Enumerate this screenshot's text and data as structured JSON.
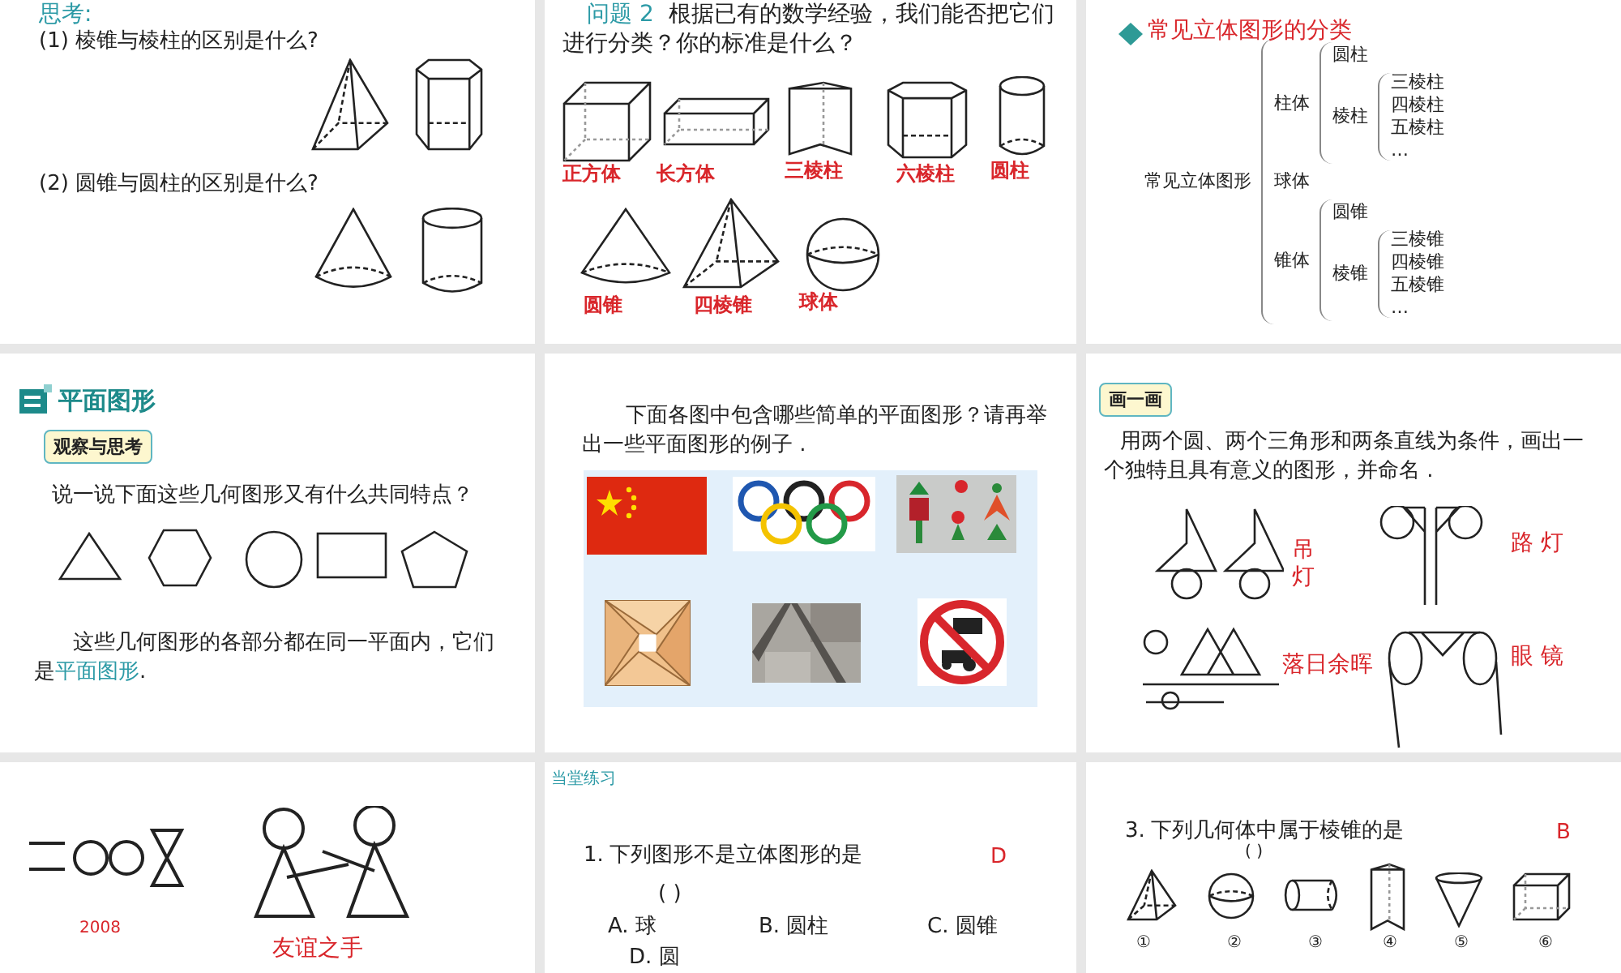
{
  "slides": [
    {
      "kind": "think",
      "heading": "思考:",
      "questions": [
        "(1) 棱锥与棱柱的区别是什么?",
        "(2) 圆锥与圆柱的区别是什么?"
      ]
    },
    {
      "kind": "solids",
      "prompt_label": "问题 2",
      "prompt": "根据已有的数学经验，我们能否把它们进行分类？你的标准是什么？",
      "labels": [
        "正方体",
        "长方体",
        "三棱柱",
        "六棱柱",
        "圆柱",
        "圆锥",
        "四棱锥",
        "球体"
      ]
    },
    {
      "kind": "tree",
      "title": "常见立体图形的分类",
      "tree": {
        "label": "常见立体图形",
        "children": [
          {
            "label": "柱体",
            "children": [
              {
                "label": "圆柱"
              },
              {
                "label": "棱柱",
                "children": [
                  {
                    "label": "三棱柱"
                  },
                  {
                    "label": "四棱柱"
                  },
                  {
                    "label": "五棱柱"
                  },
                  {
                    "label": "…"
                  }
                ]
              }
            ]
          },
          {
            "label": "球体"
          },
          {
            "label": "锥体",
            "children": [
              {
                "label": "圆锥"
              },
              {
                "label": "棱锥",
                "children": [
                  {
                    "label": "三棱锥"
                  },
                  {
                    "label": "四棱锥"
                  },
                  {
                    "label": "五棱锥"
                  },
                  {
                    "label": "…"
                  }
                ]
              }
            ]
          }
        ]
      }
    },
    {
      "kind": "plane",
      "section_title": "平面图形",
      "badge": "观察与思考",
      "question": "说一说下面这些几何图形又有什么共同特点？",
      "text_before": "这些几何图形的各部分都在同一平面内，它们是",
      "term": "平面图形",
      "text_after": "."
    },
    {
      "kind": "pictures",
      "text": "下面各图中包含哪些简单的平面图形？请再举出一些平面图形的例子 ."
    },
    {
      "kind": "draw",
      "badge": "画一画",
      "text": "用两个圆、两个三角形和两条直线为条件，画出一个独特且具有意义的图形，并命名 .",
      "captions": [
        "吊灯",
        "路 灯",
        "落日余晖",
        "眼 镜"
      ]
    },
    {
      "kind": "figures",
      "captions": [
        "2008",
        "友谊之手"
      ]
    },
    {
      "kind": "exercise",
      "header": "当堂练习",
      "number": "1.",
      "question": "下列图形不是立体图形的是",
      "answer": "D",
      "blank": "( )",
      "options": [
        "A. 球",
        "B. 圆柱",
        "C. 圆锥",
        "D. 圆"
      ]
    },
    {
      "kind": "exercise2",
      "number": "3.",
      "question": "下列几何体中属于棱锥的是",
      "answer": "B",
      "blank": "( )",
      "numbers": [
        "①",
        "②",
        "③",
        "④",
        "⑤",
        "⑥"
      ]
    }
  ]
}
